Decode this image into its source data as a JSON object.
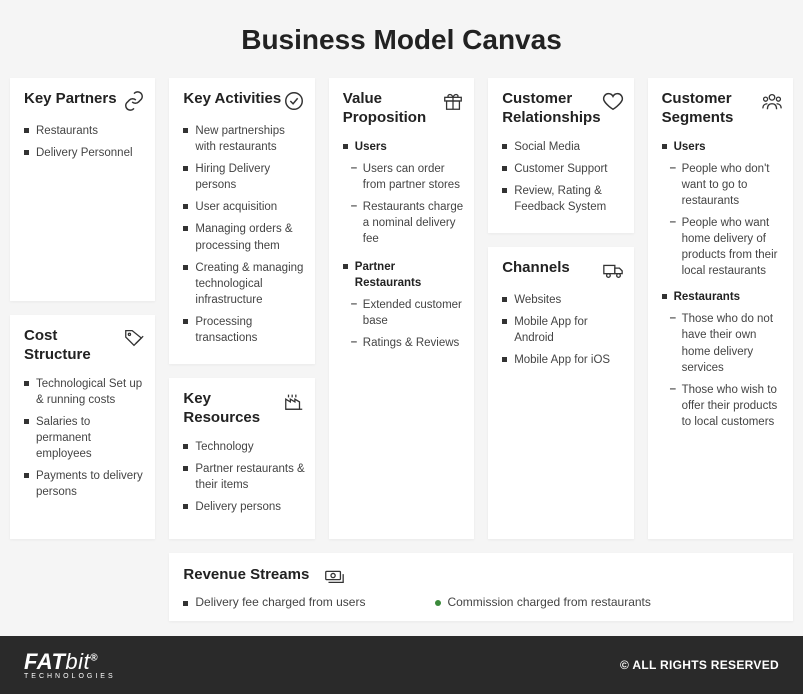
{
  "title": "Business Model Canvas",
  "blocks": {
    "key_partners": {
      "title": "Key Partners",
      "items": [
        "Restaurants",
        "Delivery Personnel"
      ]
    },
    "cost_structure": {
      "title": "Cost Structure",
      "items": [
        "Technological Set up & running costs",
        "Salaries to permanent employees",
        "Payments to delivery persons"
      ]
    },
    "key_activities": {
      "title": "Key Activities",
      "items": [
        "New partnerships with restaurants",
        "Hiring Delivery persons",
        "User acquisition",
        "Managing orders & processing them",
        "Creating & managing technological infrastructure",
        "Processing transactions"
      ]
    },
    "key_resources": {
      "title": "Key Resources",
      "items": [
        "Technology",
        "Partner restaurants & their items",
        "Delivery persons"
      ]
    },
    "value_proposition": {
      "title": "Value Proposition",
      "heading1": "Users",
      "users_items": [
        "Users can order from partner stores",
        "Restaurants charge a nominal delivery fee"
      ],
      "heading2": "Partner Restaurants",
      "partner_items": [
        "Extended customer base",
        "Ratings & Reviews"
      ]
    },
    "customer_relationships": {
      "title": "Customer Relationships",
      "items": [
        "Social Media",
        "Customer Support",
        "Review, Rating & Feedback System"
      ]
    },
    "channels": {
      "title": "Channels",
      "items": [
        "Websites",
        "Mobile App for Android",
        "Mobile App for iOS"
      ]
    },
    "customer_segments": {
      "title": "Customer Segments",
      "heading1": "Users",
      "users_items": [
        "People who don't want to go to restaurants",
        "People who want home delivery of products from their local restaurants"
      ],
      "heading2": "Restaurants",
      "rest_items": [
        "Those who do not have their own home delivery services",
        "Those who wish to offer their products to local customers"
      ]
    },
    "revenue_streams": {
      "title": "Revenue  Streams",
      "item1": "Delivery fee charged from users",
      "item2": "Commission charged from restaurants"
    }
  },
  "footer": {
    "logo_bold": "FAT",
    "logo_thin": "bit",
    "logo_sub": "TECHNOLOGIES",
    "copyright": "© ALL RIGHTS RESERVED"
  }
}
